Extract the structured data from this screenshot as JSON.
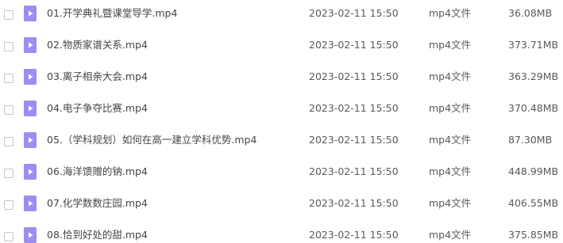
{
  "files": [
    {
      "name": "01.开学典礼暨课堂导学.mp4",
      "modified": "2023-02-11 15:50",
      "type": "mp4文件",
      "size": "36.08MB",
      "icon": "video-file-icon"
    },
    {
      "name": "02.物质家谱关系.mp4",
      "modified": "2023-02-11 15:50",
      "type": "mp4文件",
      "size": "373.71MB",
      "icon": "video-file-icon"
    },
    {
      "name": "03.离子相亲大会.mp4",
      "modified": "2023-02-11 15:50",
      "type": "mp4文件",
      "size": "363.29MB",
      "icon": "video-file-icon"
    },
    {
      "name": "04.电子争夺比赛.mp4",
      "modified": "2023-02-11 15:50",
      "type": "mp4文件",
      "size": "370.48MB",
      "icon": "video-file-icon"
    },
    {
      "name": "05.（学科规划）如何在高一建立学科优势.mp4",
      "modified": "2023-02-11 15:50",
      "type": "mp4文件",
      "size": "87.30MB",
      "icon": "video-file-icon"
    },
    {
      "name": "06.海洋馈赠的钠.mp4",
      "modified": "2023-02-11 15:50",
      "type": "mp4文件",
      "size": "448.99MB",
      "icon": "video-file-icon"
    },
    {
      "name": "07.化学数数庄园.mp4",
      "modified": "2023-02-11 15:50",
      "type": "mp4文件",
      "size": "406.55MB",
      "icon": "video-file-icon"
    },
    {
      "name": "08.恰到好处的甜.mp4",
      "modified": "2023-02-11 15:50",
      "type": "mp4文件",
      "size": "375.85MB",
      "icon": "video-file-icon"
    }
  ],
  "colors": {
    "icon_fill": "#a08bf0",
    "text": "#454545"
  }
}
